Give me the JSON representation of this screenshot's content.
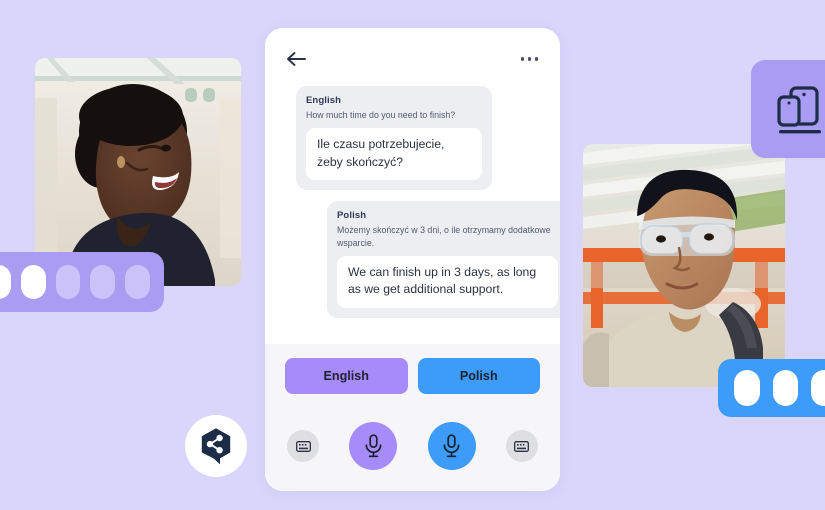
{
  "app": {
    "background_color": "#d9d5fb",
    "brand_navy": "#1e2d47",
    "accent_purple": "#a78bfa",
    "accent_blue": "#3d9bfa"
  },
  "logo": {
    "icon": "share-node-speech-bubble-logo",
    "color": "#1e2d47"
  },
  "decor": {
    "left_badge": {
      "name": "purple-pill-badge",
      "color": "#a99cf2",
      "pills": [
        "on",
        "on",
        "off",
        "off",
        "off"
      ]
    },
    "right_top_badge": {
      "name": "devices-badge",
      "color": "#a99cf2",
      "icon": "multi-device-icon"
    },
    "right_bottom_badge": {
      "name": "blue-pill-badge",
      "color": "#3d9bfa",
      "pills": [
        "on",
        "on",
        "on"
      ]
    }
  },
  "photos": {
    "left": {
      "name": "photo-woman-smiling",
      "alt": "Smiling woman with natural afro hair wearing a dark navy top"
    },
    "right": {
      "name": "photo-man-goggles",
      "alt": "Young man wearing clear safety goggles and a beige shirt in a warehouse"
    }
  },
  "phone": {
    "header": {
      "back_icon": "arrow-left-icon",
      "menu_icon": "more-horizontal-icon"
    },
    "messages": [
      {
        "language": "English",
        "source_text": "How much time do you need to finish?",
        "translated_text": "Ile czasu potrzebujecie, żeby skończyć?"
      },
      {
        "language": "Polish",
        "source_text": "Możemy skończyć w 3 dni, o ile otrzymamy dodatkowe wsparcie.",
        "translated_text": "We can finish up in 3 days, as long as we get additional support."
      }
    ],
    "language_buttons": [
      {
        "label": "English",
        "color": "#a78bfa"
      },
      {
        "label": "Polish",
        "color": "#3d9bfa"
      }
    ],
    "controls": [
      {
        "name": "keyboard-button-left",
        "icon": "keyboard-icon"
      },
      {
        "name": "mic-button-english",
        "icon": "microphone-icon"
      },
      {
        "name": "mic-button-polish",
        "icon": "microphone-icon"
      },
      {
        "name": "keyboard-button-right",
        "icon": "keyboard-icon"
      }
    ]
  }
}
